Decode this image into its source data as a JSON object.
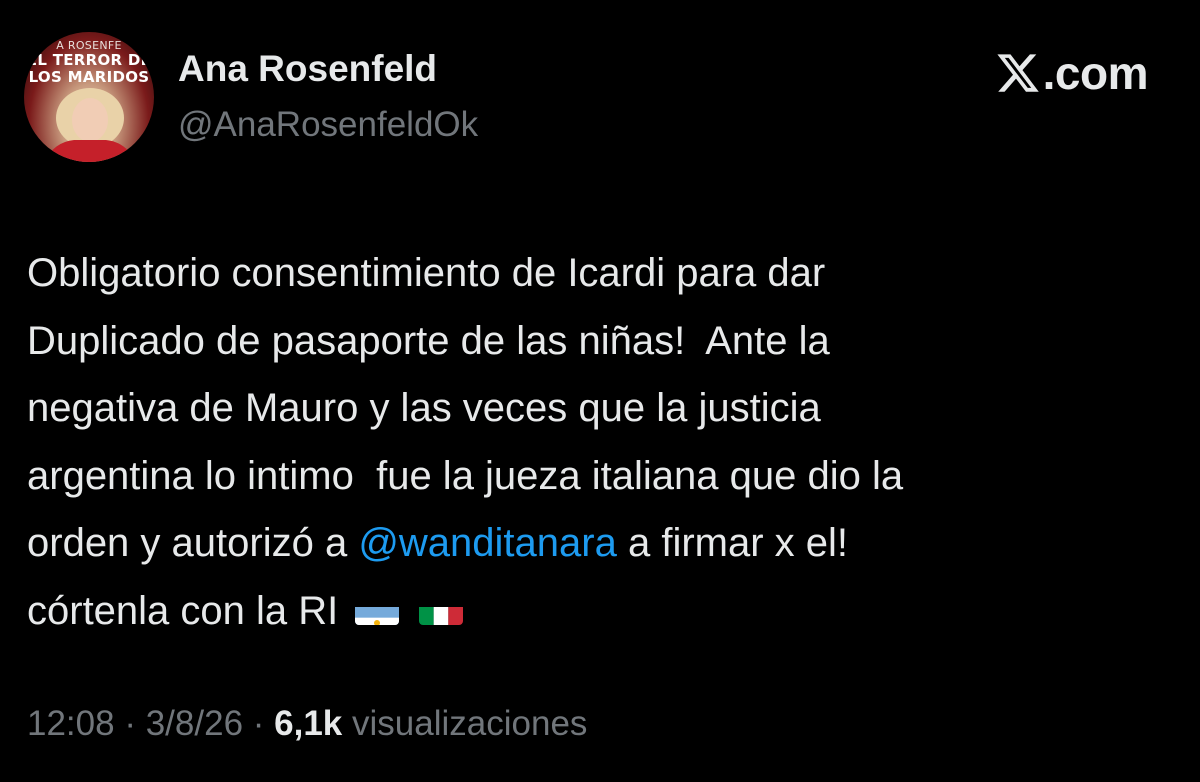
{
  "author": {
    "display_name": "Ana Rosenfeld",
    "handle": "@AnaRosenfeldOk",
    "avatar_text": {
      "line1": "A ROSENFE",
      "line2": "EL TERROR DE",
      "line3": "LOS MARIDOS"
    }
  },
  "brand": {
    "text": ".com",
    "logo_icon": "x-logo-icon"
  },
  "tweet": {
    "lines": [
      "Obligatorio consentimiento de Icardi para dar",
      "Duplicado de pasaporte de las niñas!  Ante la",
      "negativa de Mauro y las veces que la justicia",
      "argentina lo intimo  fue la jueza italiana que dio la"
    ],
    "line5_before": "orden y autorizó a ",
    "mention": "@wanditanara",
    "line5_after": " a firmar x el!",
    "line6": "córtenla con la RI",
    "flags": [
      "argentina-flag-icon",
      "italy-flag-icon"
    ]
  },
  "meta": {
    "time": "12:08",
    "separator": "·",
    "date": "3/8/26",
    "views_count": "6,1k",
    "views_label": "visualizaciones"
  },
  "colors": {
    "background": "#000000",
    "text_primary": "#e7e9ea",
    "text_secondary": "#71767b",
    "mention": "#1d9bf0"
  }
}
